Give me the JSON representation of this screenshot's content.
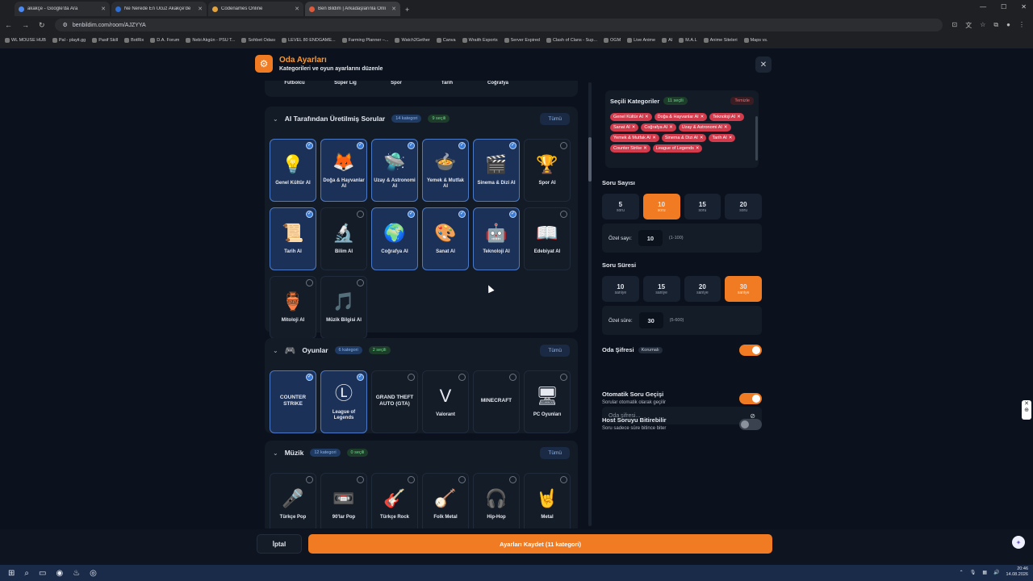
{
  "browser": {
    "tabs": [
      {
        "title": "akakçe - Google'da Ara",
        "color": "#4a8af4"
      },
      {
        "title": "Ne Nerede En Ucuz Akakçe'de",
        "color": "#2b6fd6"
      },
      {
        "title": "Codenames Online",
        "color": "#e3a23a"
      },
      {
        "title": "Ben Bildim | Arkadaşlarınla Onli",
        "color": "#e05a3a",
        "active": true
      }
    ],
    "url": "benbildim.com/room/AJZYYA",
    "bookmarks": [
      "WL MOUSE HUB",
      "Pal - playit.gg",
      "Pasif Skill",
      "BotRix",
      "D.A. Forum",
      "Nebi Akgün - PSU T...",
      "Sohbet Odası",
      "LEVEL 80 ENDGAME...",
      "Farming Planner –...",
      "Watch2Gether",
      "Canva",
      "Wraith Esports",
      "Server Expired",
      "Clash of Clans - Sup...",
      "OGM",
      "Live Anime",
      "AI",
      "M.A.L",
      "Anime Siteleri",
      "Maps vs."
    ]
  },
  "modal": {
    "title": "Oda Ayarları",
    "subtitle": "Kategorileri ve oyun ayarlarını düzenle",
    "gear_icon": "gear-icon",
    "close_icon": "close-icon"
  },
  "top_row": [
    "Futbolcu",
    "Süper Lig",
    "Spor",
    "Tarih",
    "Coğrafya"
  ],
  "top_row_partial": "...Futbolcu",
  "sections": {
    "ai": {
      "title": "AI Tarafından Üretilmiş Sorular",
      "count": "14 kategori",
      "selected": "9 seçili",
      "all": "Tümü",
      "cards": [
        {
          "label": "Genel Kültür AI",
          "icon": "💡",
          "sel": true
        },
        {
          "label": "Doğa & Hayvanlar AI",
          "icon": "🦊",
          "sel": true
        },
        {
          "label": "Uzay & Astronomi AI",
          "icon": "🛸",
          "sel": true
        },
        {
          "label": "Yemek & Mutfak AI",
          "icon": "🍲",
          "sel": true
        },
        {
          "label": "Sinema & Dizi AI",
          "icon": "🎬",
          "sel": true
        },
        {
          "label": "Spor AI",
          "icon": "🏆",
          "sel": false
        },
        {
          "label": "Tarih AI",
          "icon": "📜",
          "sel": true
        },
        {
          "label": "Bilim AI",
          "icon": "🔬",
          "sel": false
        },
        {
          "label": "Coğrafya AI",
          "icon": "🌍",
          "sel": true
        },
        {
          "label": "Sanat AI",
          "icon": "🎨",
          "sel": true
        },
        {
          "label": "Teknoloji AI",
          "icon": "🤖",
          "sel": true
        },
        {
          "label": "Edebiyat AI",
          "icon": "📖",
          "sel": false
        },
        {
          "label": "Mitoloji AI",
          "icon": "🏺",
          "sel": false
        },
        {
          "label": "Müzik Bilgisi AI",
          "icon": "🎵",
          "sel": false
        }
      ]
    },
    "games": {
      "title": "Oyunlar",
      "count": "6 kategori",
      "selected": "2 seçili",
      "all": "Tümü",
      "cards": [
        {
          "label": "",
          "logo": "COUNTER STRIKE",
          "sel": true
        },
        {
          "label": "League of Legends",
          "icon": "Ⓛ",
          "sel": true
        },
        {
          "label": "",
          "logo": "GRAND THEFT AUTO (GTA)",
          "sel": false
        },
        {
          "label": "Valorant",
          "icon": "V",
          "sel": false
        },
        {
          "label": "",
          "logo": "MINECRAFT",
          "sel": false
        },
        {
          "label": "PC Oyunları",
          "icon": "🖥",
          "sel": false
        }
      ]
    },
    "music": {
      "title": "Müzik",
      "count": "12 kategori",
      "selected": "0 seçili",
      "all": "Tümü",
      "cards": [
        {
          "label": "Türkçe Pop",
          "icon": "🎤",
          "sel": false
        },
        {
          "label": "90'lar Pop",
          "icon": "📼",
          "sel": false
        },
        {
          "label": "Türkçe Rock",
          "icon": "🎸",
          "sel": false
        },
        {
          "label": "Folk Metal",
          "icon": "🪕",
          "sel": false
        },
        {
          "label": "Hip-Hop",
          "icon": "🎧",
          "sel": false
        },
        {
          "label": "Metal",
          "icon": "🤘",
          "sel": false
        }
      ]
    }
  },
  "selected_categories": {
    "title": "Seçili Kategoriler",
    "count": "11 seçili",
    "clear": "Temizle",
    "chips": [
      "Genel Kültür AI",
      "Doğa & Hayvanlar AI",
      "Teknoloji AI",
      "Sanat AI",
      "Coğrafya AI",
      "Uzay & Astronomi AI",
      "Yemek & Mutfak AI",
      "Sinema & Dizi AI",
      "Tarih AI",
      "Counter Strike",
      "League of Legends"
    ]
  },
  "question_count": {
    "title": "Soru Sayısı",
    "options": [
      {
        "n": "5",
        "u": "soru"
      },
      {
        "n": "10",
        "u": "soru",
        "on": true
      },
      {
        "n": "15",
        "u": "soru"
      },
      {
        "n": "20",
        "u": "soru"
      }
    ],
    "custom_label": "Özel sayı:",
    "custom_value": "10",
    "custom_range": "(1-100)"
  },
  "question_time": {
    "title": "Soru Süresi",
    "options": [
      {
        "n": "10",
        "u": "saniye"
      },
      {
        "n": "15",
        "u": "saniye"
      },
      {
        "n": "20",
        "u": "saniye"
      },
      {
        "n": "30",
        "u": "saniye",
        "on": true
      }
    ],
    "custom_label": "Özel süre:",
    "custom_value": "30",
    "custom_range": "(5-600)"
  },
  "room_password": {
    "title": "Oda Şifresi",
    "badge": "Korumalı",
    "placeholder": "Oda şifresi...",
    "enabled": true
  },
  "auto_next": {
    "title": "Otomatik Soru Geçişi",
    "sub": "Sorular otomatik olarak geçilir",
    "enabled": true
  },
  "host_end": {
    "title": "Host Soruyu Bitirebilir",
    "sub": "Soru sadece süre bitince biter",
    "enabled": false
  },
  "footer": {
    "cancel": "İptal",
    "save": "Ayarları Kaydet (11 kategori)"
  },
  "taskbar": {
    "time": "20:46",
    "date": "14.08.2026"
  }
}
